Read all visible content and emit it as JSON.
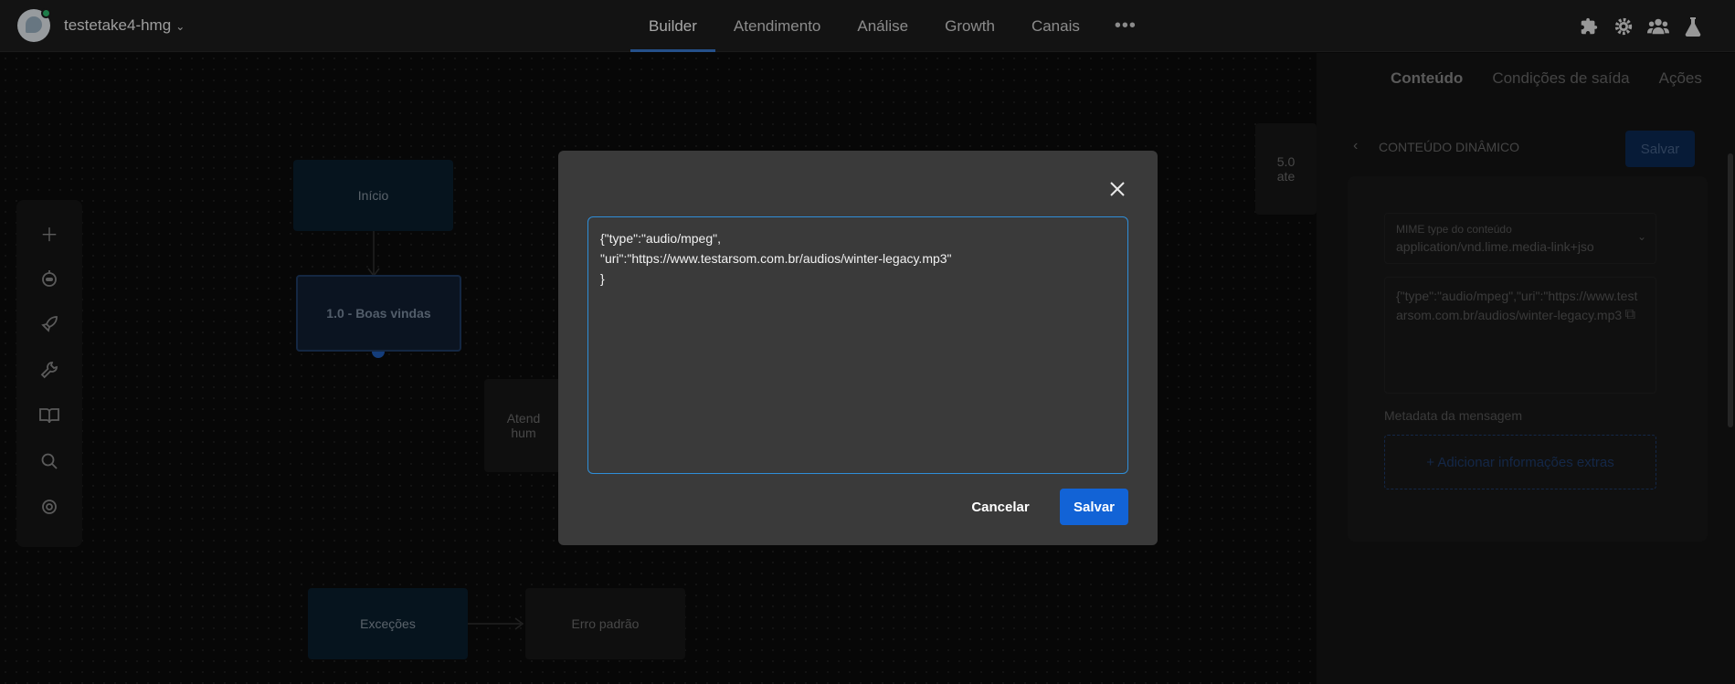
{
  "header": {
    "bot_name": "testetake4-hmg",
    "nav": [
      "Builder",
      "Atendimento",
      "Análise",
      "Growth",
      "Canais"
    ],
    "more_label": "•••",
    "icons": [
      "puzzle-icon",
      "gear-icon",
      "team-icon",
      "flask-icon"
    ]
  },
  "toolbar": {
    "icons": [
      "plus-icon",
      "bot-icon",
      "rocket-icon",
      "wrench-icon",
      "book-icon",
      "search-icon",
      "support-icon"
    ]
  },
  "nodes": {
    "inicio": "Início",
    "boas_vindas": "1.0 - Boas vindas",
    "atend": "Atend\nhum",
    "cinco": "5.0\nate",
    "excecoes": "Exceções",
    "erro": "Erro padrão"
  },
  "panel": {
    "tabs": [
      "Conteúdo",
      "Condições de saída",
      "Ações"
    ],
    "title": "CONTEÚDO DINÂMICO",
    "save_label": "Salvar",
    "mime_label": "MIME type do conteúdo",
    "mime_value": "application/vnd.lime.media-link+jso",
    "content_preview": "{\"type\":\"audio/mpeg\",\"uri\":\"https://www.testarsom.com.br/audios/winter-legacy.mp3",
    "meta_label": "Metadata da mensagem",
    "meta_add": "+ Adicionar informações extras"
  },
  "modal": {
    "text": "{\"type\":\"audio/mpeg\",\n\"uri\":\"https://www.testarsom.com.br/audios/winter-legacy.mp3\"\n}",
    "cancel_label": "Cancelar",
    "save_label": "Salvar"
  }
}
